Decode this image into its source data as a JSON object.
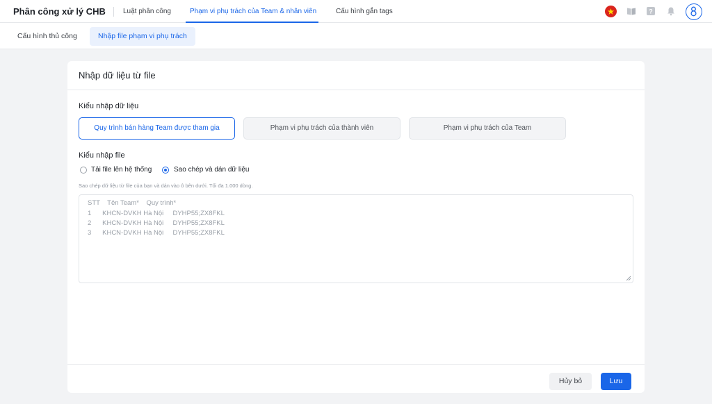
{
  "app": {
    "title": "Phân công xử lý CHB"
  },
  "nav": {
    "tabs": [
      {
        "label": "Luật phân công"
      },
      {
        "label": "Phạm vi phụ trách của Team & nhân viên",
        "active": true
      },
      {
        "label": "Cấu hình gắn tags"
      }
    ],
    "icons": [
      "vietnam-flag-icon",
      "book-icon",
      "help-icon",
      "bell-icon",
      "avatar-icon"
    ]
  },
  "subnav": {
    "tabs": [
      {
        "label": "Cấu hình thủ công"
      },
      {
        "label": "Nhập file phạm vi phụ trách",
        "active": true
      }
    ]
  },
  "form": {
    "title": "Nhập dữ liệu từ file",
    "import_type_label": "Kiểu nhập dữ liệu",
    "import_types": [
      {
        "label": "Quy trình bán hàng Team được tham gia",
        "selected": true
      },
      {
        "label": "Phạm vi phụ trách của thành viên"
      },
      {
        "label": "Phạm vi phụ trách của Team"
      }
    ],
    "file_type_label": "Kiểu nhập file",
    "file_types": [
      {
        "label": "Tải file lên hệ thống",
        "checked": false
      },
      {
        "label": "Sao chép và dán dữ liệu",
        "checked": true
      }
    ],
    "hint": "Sao chép dữ liệu từ file của bạn và dán vào ô bên dưới. Tối đa 1.000 dòng.",
    "placeholder_lines": [
      "STT    Tên Team*    Quy trình*",
      "1      KHCN-DVKH Hà Nội     DYHP55;ZX8FKL",
      "2      KHCN-DVKH Hà Nội     DYHP55;ZX8FKL",
      "3      KHCN-DVKH Hà Nội     DYHP55;ZX8FKL"
    ],
    "cancel_label": "Hủy bỏ",
    "save_label": "Lưu"
  },
  "colors": {
    "accent": "#1a66e8",
    "background": "#f2f3f5"
  }
}
